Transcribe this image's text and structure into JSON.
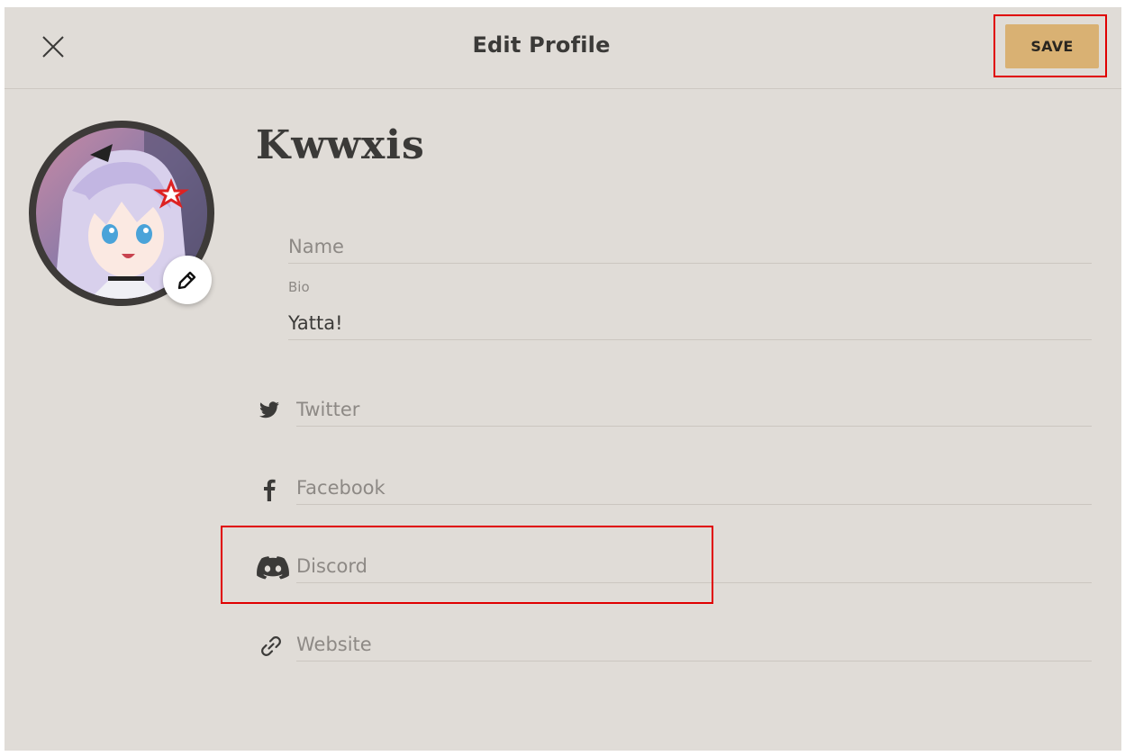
{
  "header": {
    "title": "Edit Profile",
    "save_label": "SAVE"
  },
  "profile": {
    "username": "Kwwxis"
  },
  "fields": {
    "name": {
      "placeholder": "Name",
      "value": ""
    },
    "bio": {
      "label": "Bio",
      "value": "Yatta!"
    }
  },
  "social": {
    "twitter": {
      "placeholder": "Twitter",
      "icon": "twitter-icon"
    },
    "facebook": {
      "placeholder": "Facebook",
      "icon": "facebook-icon"
    },
    "discord": {
      "placeholder": "Discord",
      "icon": "discord-icon"
    },
    "website": {
      "placeholder": "Website",
      "icon": "link-icon"
    }
  },
  "colors": {
    "background": "#e0dcd7",
    "accent": "#d9b173",
    "highlight": "#e00000",
    "text": "#3b3a38"
  }
}
